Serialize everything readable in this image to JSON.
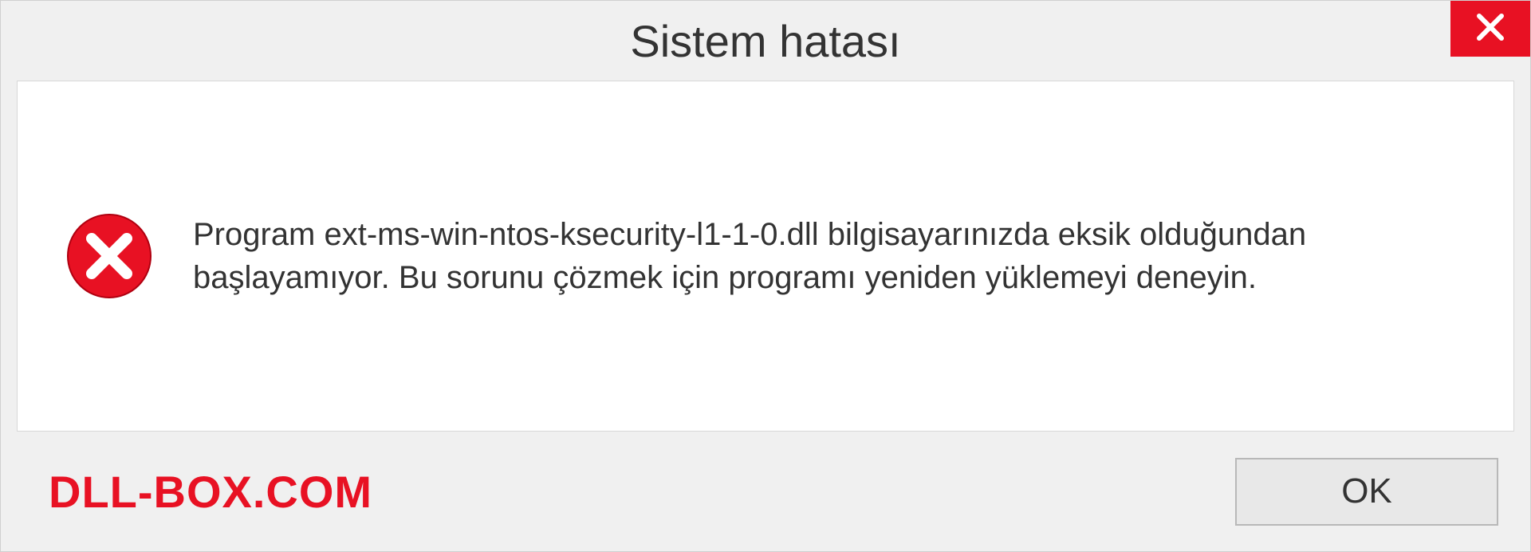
{
  "dialog": {
    "title": "Sistem hatası",
    "message": "Program ext-ms-win-ntos-ksecurity-l1-1-0.dll bilgisayarınızda eksik olduğundan başlayamıyor. Bu sorunu çözmek için programı yeniden yüklemeyi deneyin.",
    "ok_label": "OK",
    "watermark": "DLL-BOX.COM"
  },
  "colors": {
    "close_red": "#e81123",
    "watermark_red": "#e81123"
  }
}
